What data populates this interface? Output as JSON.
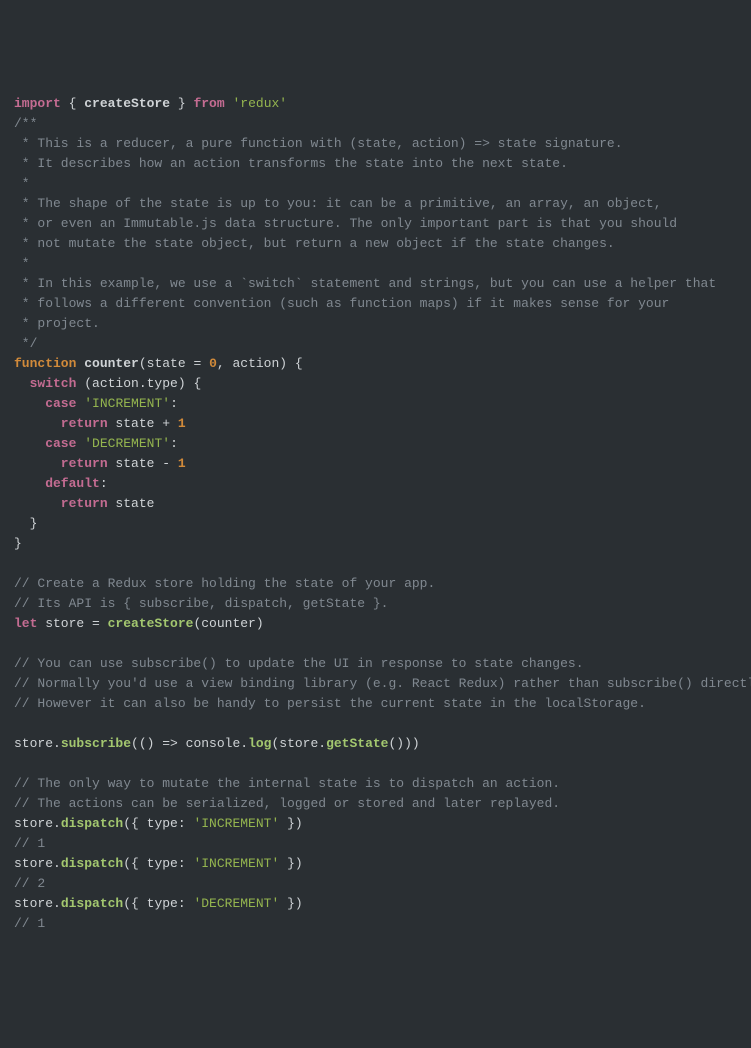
{
  "code": {
    "l1": {
      "import": "import",
      "open": " { ",
      "createStore": "createStore",
      "close": " } ",
      "from": "from",
      "sp": " ",
      "redux": "'redux'"
    },
    "c1": "/**",
    "c2": " * This is a reducer, a pure function with (state, action) => state signature.",
    "c3": " * It describes how an action transforms the state into the next state.",
    "c4": " *",
    "c5": " * The shape of the state is up to you: it can be a primitive, an array, an object,",
    "c6": " * or even an Immutable.js data structure. The only important part is that you should",
    "c7": " * not mutate the state object, but return a new object if the state changes.",
    "c8": " *",
    "c9": " * In this example, we use a `switch` statement and strings, but you can use a helper that",
    "c10": " * follows a different convention (such as function maps) if it makes sense for your",
    "c11": " * project.",
    "c12": " */",
    "fn": {
      "kw": "function",
      "name": " counter",
      "args_open": "(state = ",
      "zero": "0",
      "args_rest": ", action) {"
    },
    "sw": {
      "kw": "  switch",
      "expr": " (action.type) {"
    },
    "case1": {
      "kw": "    case",
      "sp": " ",
      "str": "'INCREMENT'",
      "colon": ":"
    },
    "ret1": {
      "kw": "      return",
      "expr": " state + ",
      "num": "1"
    },
    "case2": {
      "kw": "    case",
      "sp": " ",
      "str": "'DECREMENT'",
      "colon": ":"
    },
    "ret2": {
      "kw": "      return",
      "expr": " state - ",
      "num": "1"
    },
    "def": {
      "kw": "    default",
      "colon": ":"
    },
    "ret3": {
      "kw": "      return",
      "expr": " state"
    },
    "brace1": "  }",
    "brace2": "}",
    "c13": "// Create a Redux store holding the state of your app.",
    "c14": "// Its API is { subscribe, dispatch, getState }.",
    "let": {
      "kw": "let",
      "rest1": " store = ",
      "call": "createStore",
      "rest2": "(counter)"
    },
    "c15": "// You can use subscribe() to update the UI in response to state changes.",
    "c16": "// Normally you'd use a view binding library (e.g. React Redux) rather than subscribe() directly.",
    "c17": "// However it can also be handy to persist the current state in the localStorage.",
    "sub": {
      "a": "store.",
      "fn1": "subscribe",
      "b": "(() => console.",
      "fn2": "log",
      "c": "(store.",
      "fn3": "getState",
      "d": "()))"
    },
    "c18": "// The only way to mutate the internal state is to dispatch an action.",
    "c19": "// The actions can be serialized, logged or stored and later replayed.",
    "d1": {
      "a": "store.",
      "fn": "dispatch",
      "b": "({ type: ",
      "str": "'INCREMENT'",
      "c": " })"
    },
    "c20": "// 1",
    "d2": {
      "a": "store.",
      "fn": "dispatch",
      "b": "({ type: ",
      "str": "'INCREMENT'",
      "c": " })"
    },
    "c21": "// 2",
    "d3": {
      "a": "store.",
      "fn": "dispatch",
      "b": "({ type: ",
      "str": "'DECREMENT'",
      "c": " })"
    },
    "c22": "// 1"
  }
}
